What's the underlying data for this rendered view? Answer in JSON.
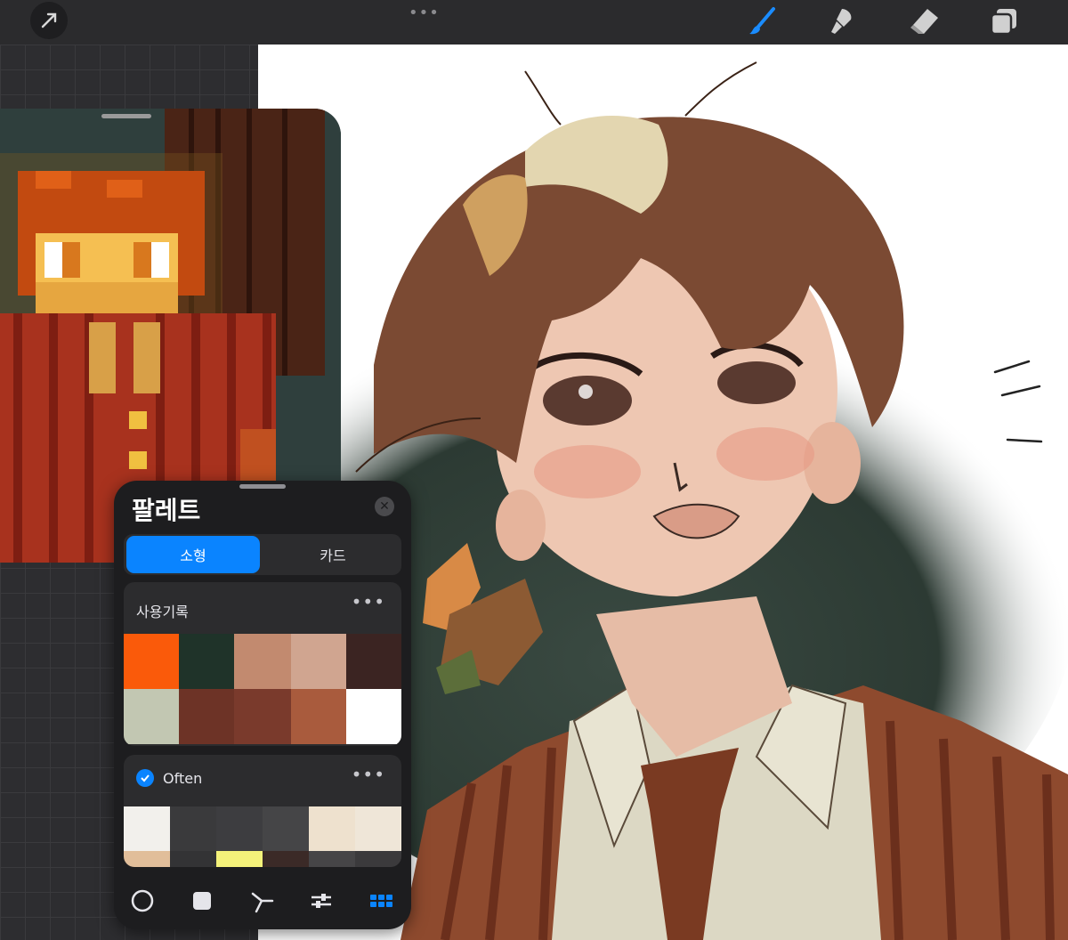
{
  "toolbar": {
    "left_icon": "move-arrow-icon",
    "more_dots": "•••",
    "tools": [
      {
        "name": "brush-icon",
        "active": true
      },
      {
        "name": "smudge-icon",
        "active": false
      },
      {
        "name": "eraser-icon",
        "active": false
      },
      {
        "name": "layers-icon",
        "active": false
      }
    ],
    "accent_color": "#1a8cff"
  },
  "palette": {
    "title": "팔레트",
    "view_options": [
      {
        "label": "소형",
        "active": true
      },
      {
        "label": "카드",
        "active": false
      }
    ],
    "history": {
      "title": "사용기록",
      "more": "•••",
      "colors": [
        [
          "#fa5a0a",
          "#1f3329",
          "#c28a6f",
          "#d0a590",
          "#3b2422"
        ],
        [
          "#c2c7b2",
          "#6d3326",
          "#7a3a2c",
          "#a95b3d",
          "#ffffff"
        ]
      ]
    },
    "often": {
      "title": "Often",
      "checked": true,
      "more": "•••",
      "colors": [
        [
          "#f2f0ec",
          "#3a3a3c",
          "#3d3d40",
          "#454547",
          "#eee1ce",
          "#efe6d8"
        ],
        [
          "#e1be9a",
          "#333335",
          "#f4f27a",
          "#3b2a27",
          "#464547",
          "#3b3a3c"
        ]
      ]
    },
    "bottom_bar": [
      {
        "name": "disc-icon",
        "active": false
      },
      {
        "name": "classic-icon",
        "active": false
      },
      {
        "name": "harmony-icon",
        "active": false
      },
      {
        "name": "value-icon",
        "active": false
      },
      {
        "name": "palettes-icon",
        "active": true
      }
    ]
  }
}
